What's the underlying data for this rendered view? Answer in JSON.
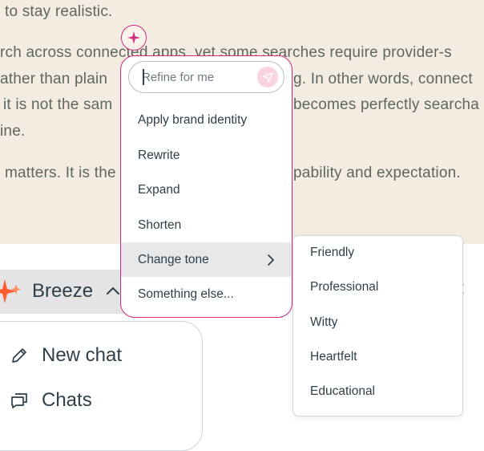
{
  "document": {
    "lines": [
      "to stay realistic.",
      "rch across connected apps, yet some searches require provider-s",
      "ather than plain",
      "g. In other words, connect",
      "it is not the sam",
      "becomes perfectly searcha",
      "ine.",
      "matters. It is the",
      "pability and expectation."
    ]
  },
  "breeze": {
    "label": "Breeze",
    "panel": {
      "items": [
        {
          "label": "New chat",
          "icon": "pencil-icon"
        },
        {
          "label": "Chats",
          "icon": "chat-bubbles-icon"
        }
      ]
    }
  },
  "ai_menu": {
    "icon": "sparkle-icon",
    "refine_placeholder": "Refine for me",
    "send_icon": "send-icon",
    "items": [
      {
        "label": "Apply brand identity"
      },
      {
        "label": "Rewrite"
      },
      {
        "label": "Expand"
      },
      {
        "label": "Shorten"
      },
      {
        "label": "Change tone",
        "has_submenu": true
      },
      {
        "label": "Something else..."
      }
    ]
  },
  "tone_menu": {
    "items": [
      "Friendly",
      "Professional",
      "Witty",
      "Heartfelt",
      "Educational"
    ]
  },
  "colors": {
    "accent": "#d3297d",
    "doc_background": "#f4ece0",
    "doc_text": "#5d6660",
    "active_item": "#e8e8e8",
    "breeze_orange": "#ff5c35"
  }
}
